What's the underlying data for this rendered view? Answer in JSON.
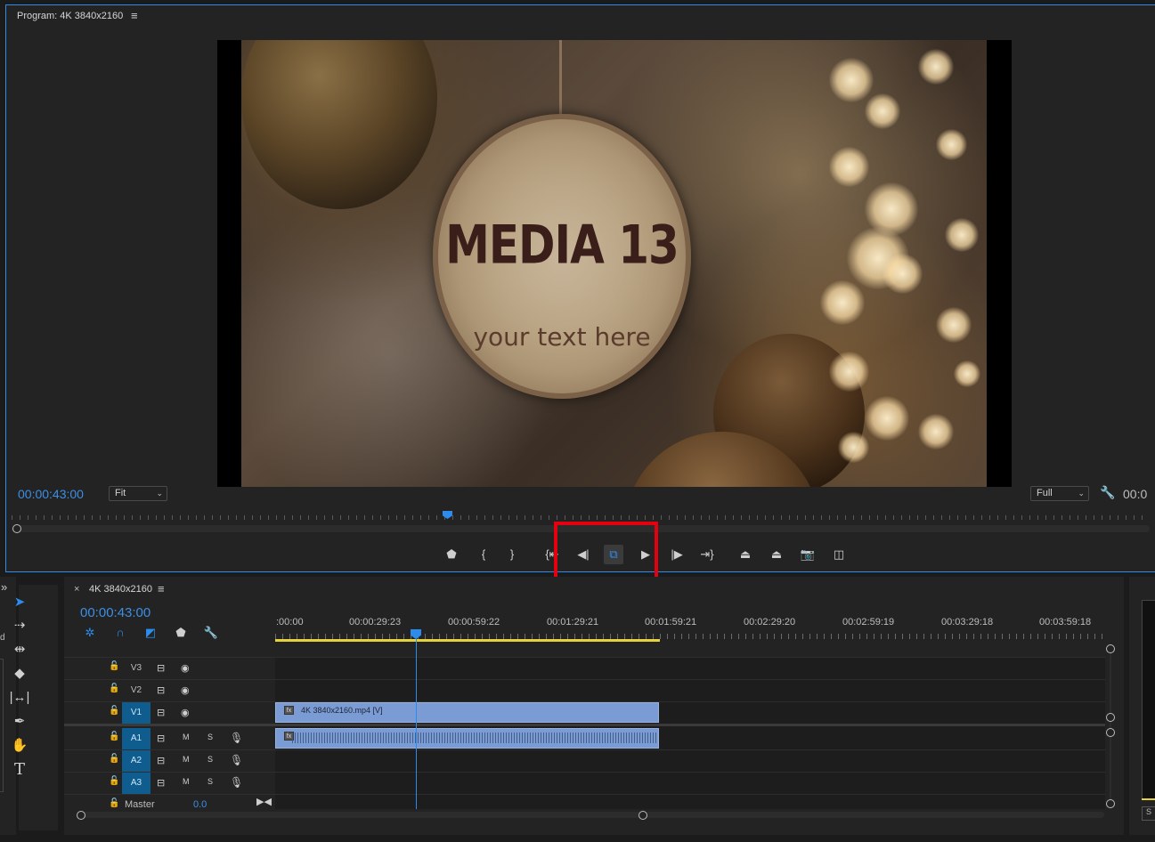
{
  "program_monitor": {
    "title": "Program: 4K 3840x2160",
    "menu_icon": "hamburger-icon",
    "video": {
      "ornament_title": "MEDIA 13",
      "ornament_subtitle": "your text here"
    },
    "timecode": "00:00:43:00",
    "zoom_select": "Fit",
    "resolution_select": "Full",
    "timecode_right": "00:0",
    "transport_controls": [
      {
        "name": "add-marker",
        "icon": "marker-icon"
      },
      {
        "name": "mark-in",
        "icon": "mark-in-icon"
      },
      {
        "name": "mark-out",
        "icon": "mark-out-icon"
      },
      {
        "name": "go-to-in",
        "icon": "go-to-in-icon"
      },
      {
        "name": "step-back",
        "icon": "step-back-icon"
      },
      {
        "name": "toggle-proxies",
        "icon": "toggle-proxies-icon"
      },
      {
        "name": "play",
        "icon": "play-icon"
      },
      {
        "name": "step-forward",
        "icon": "step-forward-icon"
      },
      {
        "name": "go-to-out",
        "icon": "go-to-out-icon"
      },
      {
        "name": "lift",
        "icon": "lift-icon"
      },
      {
        "name": "extract",
        "icon": "extract-icon"
      },
      {
        "name": "export-frame",
        "icon": "camera-icon"
      },
      {
        "name": "comparison-view",
        "icon": "comparison-view-icon"
      }
    ],
    "highlight_color": "#e3000f"
  },
  "tools": [
    {
      "name": "selection-tool",
      "icon": "arrow-icon",
      "active": true
    },
    {
      "name": "track-select-tool",
      "icon": "track-select-icon"
    },
    {
      "name": "ripple-edit-tool",
      "icon": "ripple-edit-icon"
    },
    {
      "name": "razor-tool",
      "icon": "razor-icon"
    },
    {
      "name": "slip-tool",
      "icon": "slip-icon"
    },
    {
      "name": "pen-tool",
      "icon": "pen-icon"
    },
    {
      "name": "hand-tool",
      "icon": "hand-icon"
    },
    {
      "name": "type-tool",
      "icon": "type-icon"
    }
  ],
  "timeline": {
    "tab_title": "4K 3840x2160",
    "close_label": "×",
    "timecode": "00:00:43:00",
    "ruler_labels": [
      ":00:00",
      "00:00:29:23",
      "00:00:59:22",
      "00:01:29:21",
      "00:01:59:21",
      "00:02:29:20",
      "00:02:59:19",
      "00:03:29:18",
      "00:03:59:18"
    ],
    "tracks": {
      "v3": "V3",
      "v2": "V2",
      "v1": "V1",
      "a1": "A1",
      "a2": "A2",
      "a3": "A3"
    },
    "mute_label": "M",
    "solo_label": "S",
    "video_clip_label": "4K 3840x2160.mp4 [V]",
    "fx_label": "fx",
    "master_label": "Master",
    "master_value": "0.0",
    "accent_color": "#2d8ceb",
    "clip_color": "#7a9bd3",
    "work_area_color": "#e6d23a"
  },
  "side_labels": {
    "left_d": "d",
    "right_btn": "S"
  }
}
